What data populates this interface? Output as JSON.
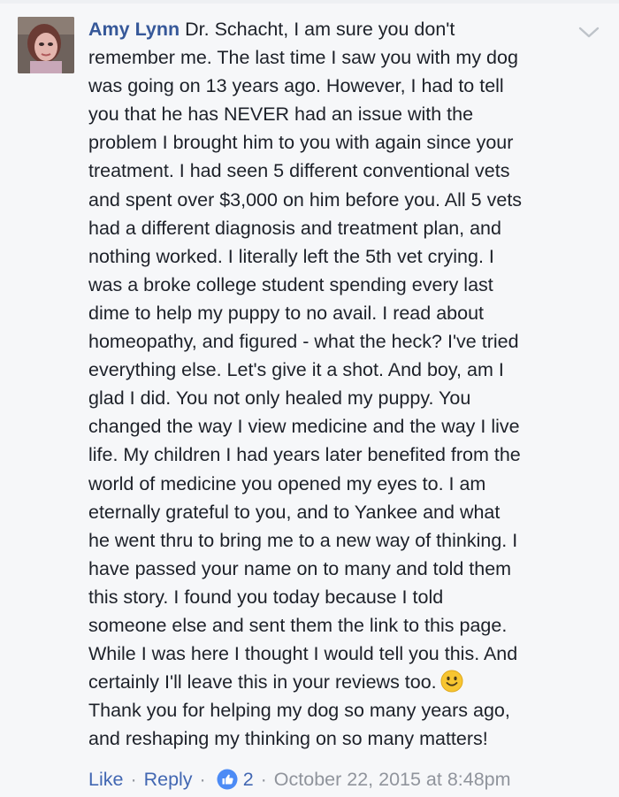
{
  "comment": {
    "author": "Amy Lynn",
    "body_lines": [
      "Dr. Schacht, I am sure you don't",
      "remember me. The last time I saw you with my dog",
      "was going on 13 years ago. However, I had to tell",
      "you that he has NEVER had an issue with the",
      "problem I brought him to you with again since your",
      "treatment. I had seen 5 different conventional vets",
      "and spent over $3,000 on him before you. All 5 vets",
      "had a different diagnosis and treatment plan, and",
      "nothing worked. I literally left the 5th vet crying. I",
      "was a broke college student spending every last",
      "dime to help my puppy to no avail. I read about",
      "homeopathy, and figured - what the heck? I've tried",
      "everything else. Let's give it a shot. And boy, am I",
      "glad I did. You not only healed my puppy. You",
      "changed the way I view medicine and the way I live",
      "life. My children I had years later benefited from the",
      "world of medicine you opened my eyes to. I am",
      "eternally grateful to you, and to Yankee and what",
      "he went thru to bring me to a new way of thinking. I",
      "have passed your name on to many and told them",
      "this story. I found you today because I told",
      "someone else and sent them the link to this page.",
      "While I was here I thought I would tell you this. And",
      "certainly I'll leave this in your reviews too.",
      "Thank you for helping my dog so many years ago,",
      "and reshaping my thinking on so many matters!"
    ],
    "emoji_icon": "smile-emoji-icon",
    "menu_icon": "chevron-down-icon"
  },
  "meta": {
    "like_label": "Like",
    "reply_label": "Reply",
    "separator": "·",
    "reaction_icon": "like-thumb-icon",
    "reaction_count": "2",
    "timestamp": "October 22, 2015 at 8:48pm"
  },
  "colors": {
    "link": "#365899",
    "action": "#4267b2",
    "text": "#1d2129",
    "muted": "#90949c",
    "background": "#f6f7f9",
    "emoji": "#f7c531"
  }
}
